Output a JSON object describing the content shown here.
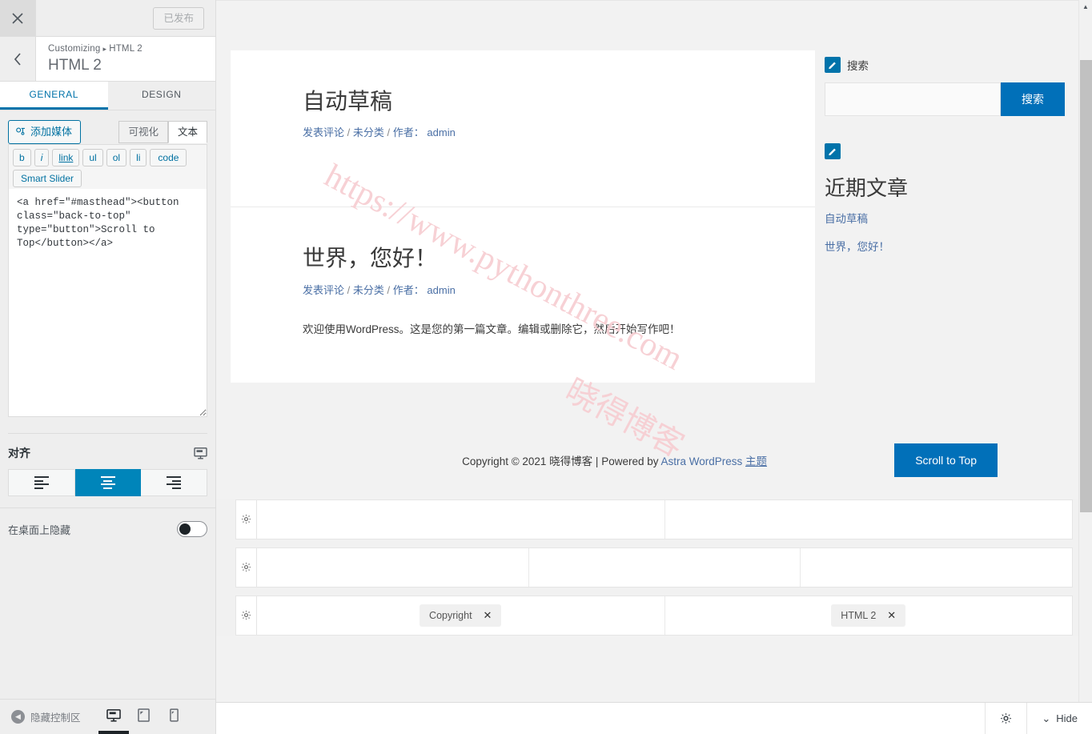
{
  "customizer": {
    "close_label": "✕",
    "publish_label": "已发布",
    "back_label": "‹",
    "breadcrumb_root": "Customizing",
    "breadcrumb_sep": "▸",
    "breadcrumb_current": "HTML 2",
    "panel_title": "HTML 2",
    "tabs": [
      {
        "label": "GENERAL",
        "active": true
      },
      {
        "label": "DESIGN",
        "active": false
      }
    ],
    "editor": {
      "add_media_label": "添加媒体",
      "mode_tabs": [
        {
          "label": "可视化",
          "active": false
        },
        {
          "label": "文本",
          "active": true
        }
      ],
      "quicktags": [
        "b",
        "i",
        "link",
        "ul",
        "ol",
        "li",
        "code",
        "Smart Slider"
      ],
      "code_value": "<a href=\"#masthead\"><button class=\"back-to-top\" type=\"button\">Scroll to Top</button></a>"
    },
    "align": {
      "label": "对齐",
      "responsive_icon": "desktop-icon",
      "options": [
        {
          "name": "align-left",
          "active": false
        },
        {
          "name": "align-center",
          "active": true
        },
        {
          "name": "align-right",
          "active": false
        }
      ]
    },
    "hide_on_desktop": {
      "label": "在桌面上隐藏",
      "enabled": false
    },
    "footer": {
      "collapse_label": "隐藏控制区",
      "devices": [
        {
          "name": "desktop",
          "active": true
        },
        {
          "name": "tablet",
          "active": false
        },
        {
          "name": "mobile",
          "active": false
        }
      ]
    }
  },
  "preview": {
    "watermark_line1": "https://www.pythonthree.com",
    "watermark_line2": "晓得博客",
    "posts": [
      {
        "title": "自动草稿",
        "meta_comment": "发表评论",
        "meta_category": "未分类",
        "meta_author_label": "作者：",
        "meta_author": "admin",
        "excerpt": ""
      },
      {
        "title": "世界，您好！",
        "meta_comment": "发表评论",
        "meta_category": "未分类",
        "meta_author_label": "作者：",
        "meta_author": "admin",
        "excerpt": "欢迎使用WordPress。这是您的第一篇文章。编辑或删除它，然后开始写作吧！"
      }
    ],
    "sidebar": {
      "search_widget": {
        "title": "搜索",
        "input_value": "",
        "button_label": "搜索"
      },
      "recent_widget": {
        "title": "近期文章",
        "items": [
          "自动草稿",
          "世界，您好！"
        ]
      }
    },
    "site_footer": {
      "copyright_prefix": "Copyright © 2021 晓得博客 | Powered by ",
      "copyright_link": "Astra WordPress ",
      "copyright_link_suffix": "主题",
      "scroll_top_label": "Scroll to Top"
    },
    "footer_widget_rows": [
      {
        "columns": [
          {
            "chip": null
          },
          {
            "chip": null
          }
        ]
      },
      {
        "columns": [
          {
            "chip": null
          },
          {
            "chip": null
          },
          {
            "chip": null
          }
        ]
      },
      {
        "columns": [
          {
            "chip": "Copyright"
          },
          {
            "chip": "HTML 2"
          }
        ]
      }
    ],
    "bottom_bar": {
      "settings_icon": "gear-icon",
      "hide_label": "Hide",
      "hide_chevron": "⌄"
    }
  },
  "colors": {
    "accent": "#0170b9",
    "link": "#4a6fa5",
    "tab_active": "#0073aa",
    "align_active": "#0085ba",
    "watermark": "#f7cfd3"
  }
}
